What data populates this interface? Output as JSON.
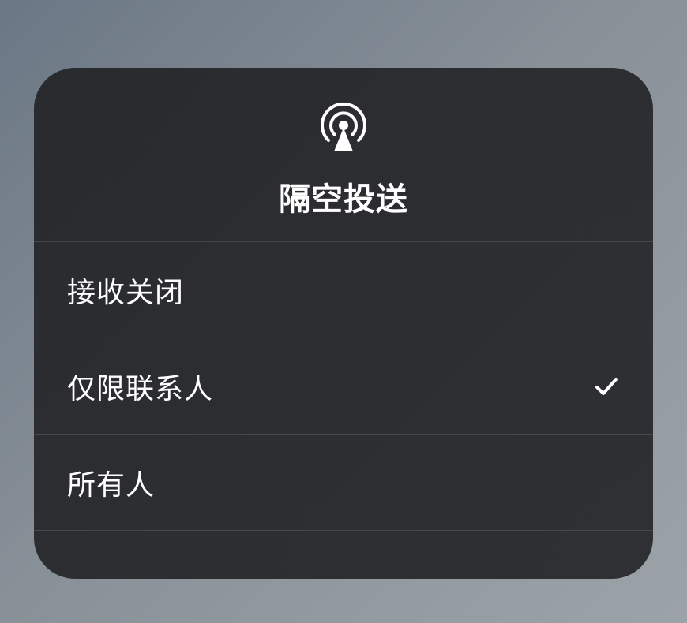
{
  "card": {
    "title": "隔空投送",
    "icon": "airdrop-icon"
  },
  "options": [
    {
      "label": "接收关闭",
      "selected": false
    },
    {
      "label": "仅限联系人",
      "selected": true
    },
    {
      "label": "所有人",
      "selected": false
    }
  ]
}
